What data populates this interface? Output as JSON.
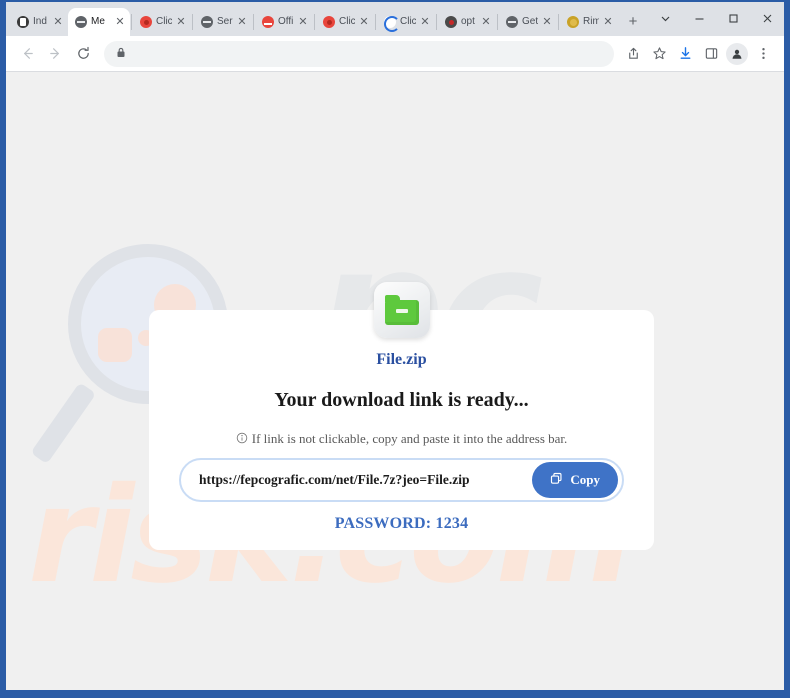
{
  "window": {
    "controls": [
      {
        "name": "tab-search",
        "label": "⌄"
      },
      {
        "name": "minimize",
        "label": "–"
      },
      {
        "name": "maximize",
        "label": "□"
      },
      {
        "name": "close",
        "label": "✕"
      }
    ]
  },
  "tabs": [
    {
      "label": "Ind",
      "favicon": "film-icon",
      "fv": "fv-film",
      "active": false,
      "sep_after": false
    },
    {
      "label": "Me",
      "favicon": "globe-icon",
      "fv": "fv-globe",
      "active": true,
      "sep_after": false
    },
    {
      "label": "Clic",
      "favicon": "red-dot-icon",
      "fv": "fv-red",
      "active": false,
      "sep_after": true
    },
    {
      "label": "Ser",
      "favicon": "globe-icon",
      "fv": "fv-globe",
      "active": false,
      "sep_after": true
    },
    {
      "label": "Offi",
      "favicon": "red-square-icon",
      "fv": "fv-redsq",
      "active": false,
      "sep_after": true
    },
    {
      "label": "Clic",
      "favicon": "red-dot-icon",
      "fv": "fv-red",
      "active": false,
      "sep_after": true
    },
    {
      "label": "Clic",
      "favicon": "blue-loader-icon",
      "fv": "fv-blue",
      "active": false,
      "sep_after": true
    },
    {
      "label": "opt",
      "favicon": "dark-dot-icon",
      "fv": "fv-dot",
      "active": false,
      "sep_after": true
    },
    {
      "label": "Get",
      "favicon": "globe-icon",
      "fv": "fv-globe",
      "active": false,
      "sep_after": true
    },
    {
      "label": "Rim",
      "favicon": "gold-circle-icon",
      "fv": "fv-gold",
      "active": false,
      "sep_after": true
    }
  ],
  "newtab_label": "+",
  "toolbar": {
    "back_icon": "back-arrow-icon",
    "forward_icon": "forward-arrow-icon",
    "reload_icon": "reload-icon",
    "lock_icon": "lock-icon",
    "omnibox_value": "",
    "omnibox_placeholder": "",
    "share_icon": "share-icon",
    "bookmark_icon": "star-icon",
    "download_icon": "download-icon",
    "sidepanel_icon": "side-panel-icon",
    "profile_icon": "profile-avatar-icon",
    "menu_icon": "three-dot-menu-icon"
  },
  "page": {
    "watermark_top": "pc",
    "watermark_bottom": "risk.com",
    "card": {
      "file_name": "File.zip",
      "file_icon": "green-zip-folder-icon",
      "headline": "Your download link is ready...",
      "subtext": "If link is not clickable, copy and paste it into the address bar.",
      "subtext_icon": "info-circle-icon",
      "url_value": "https://fepcografic.com/net/File.7z?jeo=File.zip",
      "url_placeholder": "",
      "copy_label": "Copy",
      "copy_icon": "copy-icon",
      "password_line": "PASSWORD: 1234"
    }
  },
  "colors": {
    "window_frame": "#2b5ca6",
    "accent_blue": "#3f73c7",
    "link_blue": "#2a4fa0",
    "password_blue": "#3c6cbf",
    "zip_green": "#5ec93d",
    "page_bg": "#f0f0f0",
    "watermark_peach": "#fbe6da",
    "watermark_gray": "#e6e8ea"
  }
}
